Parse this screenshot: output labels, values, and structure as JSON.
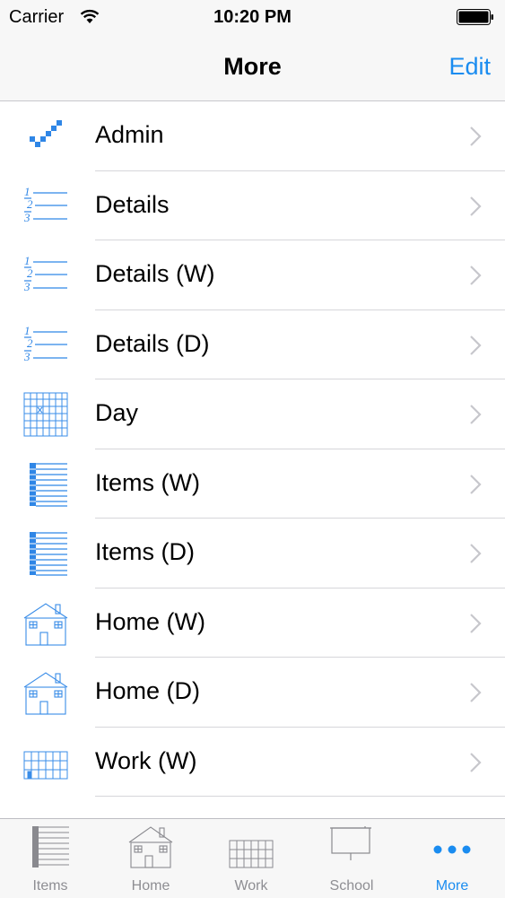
{
  "status_bar": {
    "carrier": "Carrier",
    "time": "10:20 PM"
  },
  "nav": {
    "title": "More",
    "edit_label": "Edit"
  },
  "list": {
    "items": [
      {
        "label": "Admin",
        "icon": "checkmark-icon"
      },
      {
        "label": "Details",
        "icon": "numbered-list-icon"
      },
      {
        "label": "Details (W)",
        "icon": "numbered-list-icon"
      },
      {
        "label": "Details (D)",
        "icon": "numbered-list-icon"
      },
      {
        "label": "Day",
        "icon": "grid-icon"
      },
      {
        "label": "Items (W)",
        "icon": "list-icon"
      },
      {
        "label": "Items (D)",
        "icon": "list-icon"
      },
      {
        "label": "Home (W)",
        "icon": "house-icon"
      },
      {
        "label": "Home (D)",
        "icon": "house-icon"
      },
      {
        "label": "Work (W)",
        "icon": "building-icon"
      }
    ]
  },
  "tabs": [
    {
      "label": "Items",
      "icon": "list-icon"
    },
    {
      "label": "Home",
      "icon": "house-icon"
    },
    {
      "label": "Work",
      "icon": "building-icon"
    },
    {
      "label": "School",
      "icon": "board-icon"
    },
    {
      "label": "More",
      "icon": "more-dots-icon",
      "active": true
    }
  ],
  "colors": {
    "accent": "#1a8cf0",
    "inactive": "#8e8e93",
    "separator": "#d6d6da"
  }
}
